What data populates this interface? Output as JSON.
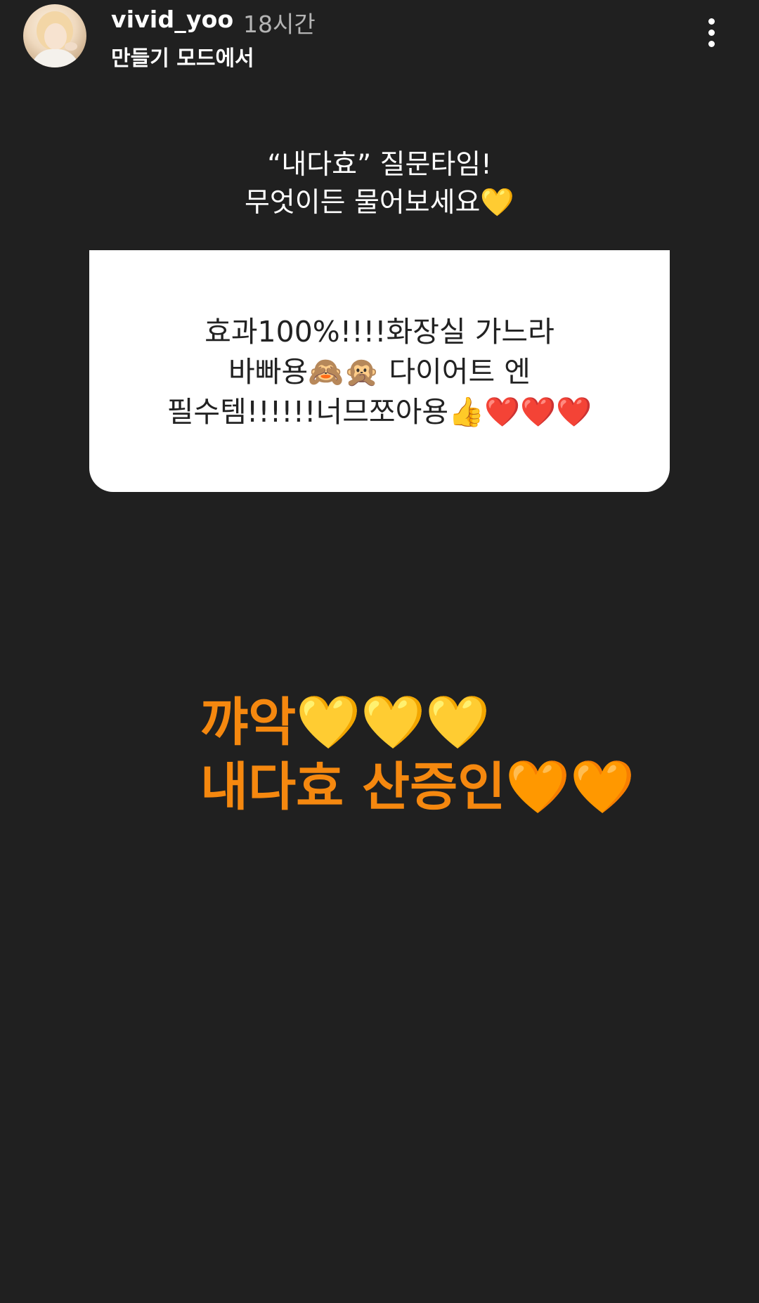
{
  "header": {
    "username": "vivid_yoo",
    "timestamp": "18시간",
    "subtitle": "만들기 모드에서",
    "more_icon": "more-vertical-icon"
  },
  "question": {
    "line1": "“내다효” 질문타임!",
    "line2": "무엇이든 물어보세요💛"
  },
  "answer": {
    "line1": "효과100%!!!!화장실 가느라",
    "line2": "바빠용🙈🙊 다이어트 엔",
    "line3": "필수템!!!!!!너므쪼아용👍❤️❤️❤️"
  },
  "caption": {
    "line1": "꺄악💛💛💛",
    "line2": "내다효 산증인🧡🧡"
  },
  "colors": {
    "background": "#202020",
    "caption": "#f5880f",
    "card": "#ffffff"
  }
}
